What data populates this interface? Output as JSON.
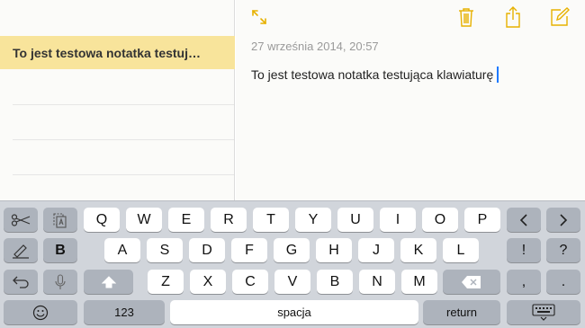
{
  "sidebar": {
    "notes": [
      {
        "title": "To jest testowa notatka testuj…"
      }
    ]
  },
  "editor": {
    "toolbar": {
      "expand_icon": "expand-arrows-icon",
      "trash_icon": "trash-icon",
      "share_icon": "share-icon",
      "compose_icon": "compose-icon"
    },
    "date": "27 września 2014, 20:57",
    "body": "To jest testowa notatka testująca klawiaturę"
  },
  "keyboard": {
    "row1": [
      "Q",
      "W",
      "E",
      "R",
      "T",
      "Y",
      "U",
      "I",
      "O",
      "P"
    ],
    "row2": [
      "A",
      "S",
      "D",
      "F",
      "G",
      "H",
      "J",
      "K",
      "L"
    ],
    "row3": [
      "Z",
      "X",
      "C",
      "V",
      "B",
      "N",
      "M"
    ],
    "bold": "B",
    "exclaim": "!",
    "question": "?",
    "comma": ",",
    "period": ".",
    "numbers": "123",
    "space": "spacja",
    "return": "return"
  },
  "colors": {
    "accent": "#e7b100",
    "selected_note": "#f8e49b",
    "caret": "#1e7aff",
    "keyboard_bg": "#d1d5db",
    "key": "#ffffff",
    "key_dark": "#adb3bc"
  }
}
